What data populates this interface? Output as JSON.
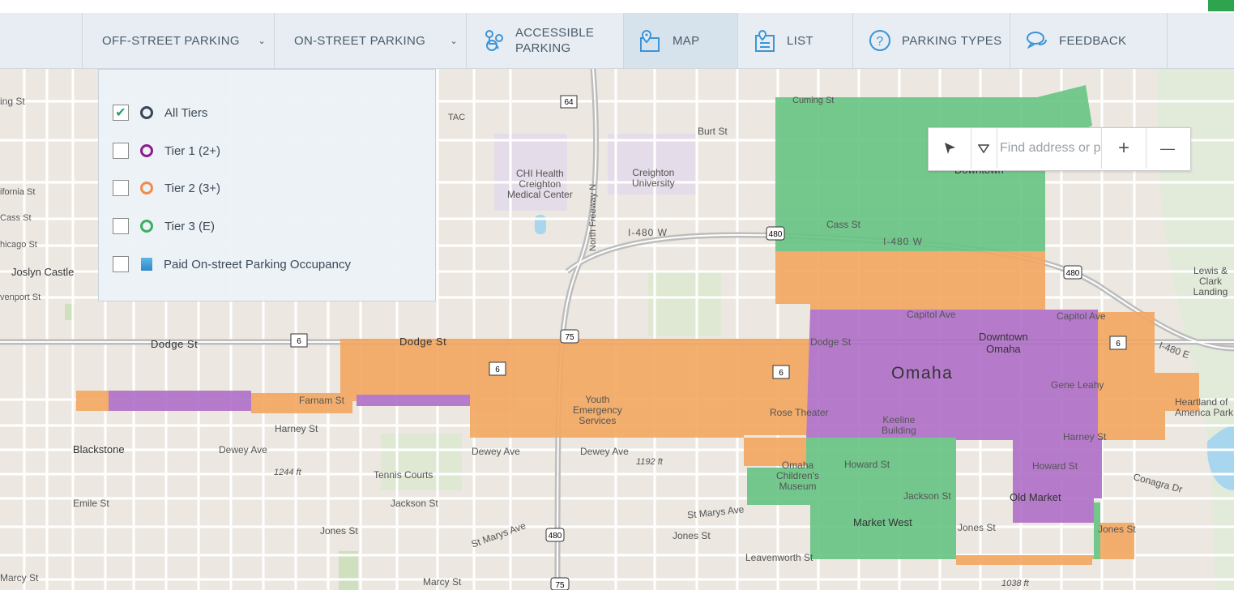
{
  "nav": {
    "off_street": "OFF-STREET PARKING",
    "on_street": "ON-STREET PARKING",
    "accessible_line1": "ACCESSIBLE",
    "accessible_line2": "PARKING",
    "map": "MAP",
    "list": "LIST",
    "parking_types": "PARKING TYPES",
    "feedback": "FEEDBACK",
    "active_tab": "MAP"
  },
  "dropdown": {
    "options": [
      {
        "label": "All Tiers",
        "checked": true,
        "color": "#38465a"
      },
      {
        "label": "Tier 1 (2+)",
        "checked": false,
        "color": "#8b1d8e"
      },
      {
        "label": "Tier 2 (3+)",
        "checked": false,
        "color": "#ef8b4f"
      },
      {
        "label": "Tier 3 (E)",
        "checked": false,
        "color": "#3fae63"
      },
      {
        "label": "Paid On-street Parking Occupancy",
        "checked": false,
        "color": "#3b95d6"
      }
    ]
  },
  "map_controls": {
    "search_placeholder": "Find address or place",
    "zoom_in": "+",
    "zoom_out": "—"
  },
  "zone_colors": {
    "tier1": "#b070c8",
    "tier2": "#f3a761",
    "tier3": "#67c483"
  },
  "map": {
    "streets": {
      "cuming": "Cuming St",
      "burt": "Burt St",
      "cass_left": "Cass St",
      "cass_right": "Cass St",
      "california": "ifornia St",
      "chicago": "hicago St",
      "davenport": "venport St",
      "dodge_left": "Dodge St",
      "dodge_mid": "Dodge St",
      "dodge_right": "Dodge St",
      "capitol_1": "Capitol Ave",
      "capitol_2": "Capitol Ave",
      "farnam": "Farnam St",
      "harney_left": "Harney St",
      "harney_right": "Harney St",
      "dewey_left": "Dewey Ave",
      "dewey_mid": "Dewey Ave",
      "dewey_right": "Dewey Ave",
      "howard_1": "Howard St",
      "howard_2": "Howard St",
      "jackson_left": "Jackson St",
      "jackson_right": "Jackson St",
      "st_marys": "St Marys Ave",
      "st_marys_2": "St Marys Ave",
      "jones_left": "Jones St",
      "jones_mid": "Jones St",
      "jones_right": "Jones St",
      "jones_far": "Jones St",
      "leavenworth": "Leavenworth St",
      "marcy_left": "Marcy St",
      "marcy_mid": "Marcy St",
      "emile": "Emile St",
      "conagra": "Conagra Dr",
      "ing": "ing St",
      "i480w_left": "I-480 W",
      "i480w_right": "I-480 W",
      "i480e": "I-480 E",
      "tac": "TAC",
      "n_freeway": "North Freeway N"
    },
    "places": {
      "joslyn": "Joslyn Castle",
      "chi_health": "CHI Health\nCreighton\nMedical Center",
      "creighton": "Creighton\nUniversity",
      "downtown_top": "Downtown",
      "downtown_omaha": "Downtown\nOmaha",
      "omaha": "Omaha",
      "gene_leahy": "Gene Leahy",
      "heartland": "Heartland of\nAmerica Park",
      "lewis_clark": "Lewis & Clark\nLanding",
      "youth": "Youth\nEmergency\nServices",
      "rose": "Rose Theater",
      "keeline": "Keeline\nBuilding",
      "omaha_childrens": "Omaha\nChildren's\nMuseum",
      "market_west": "Market West",
      "old_market": "Old Market",
      "blackstone": "Blackstone",
      "tennis": "Tennis Courts",
      "elev1": "1244 ft",
      "elev2": "1192 ft",
      "elev3": "1038 ft"
    },
    "shields": {
      "i64": "64",
      "i480a": "480",
      "i480b": "480",
      "i75a": "75",
      "us6a": "6",
      "us6b": "6",
      "us6c": "6",
      "us6d": "6",
      "i480c": "480",
      "i75b": "75"
    }
  }
}
